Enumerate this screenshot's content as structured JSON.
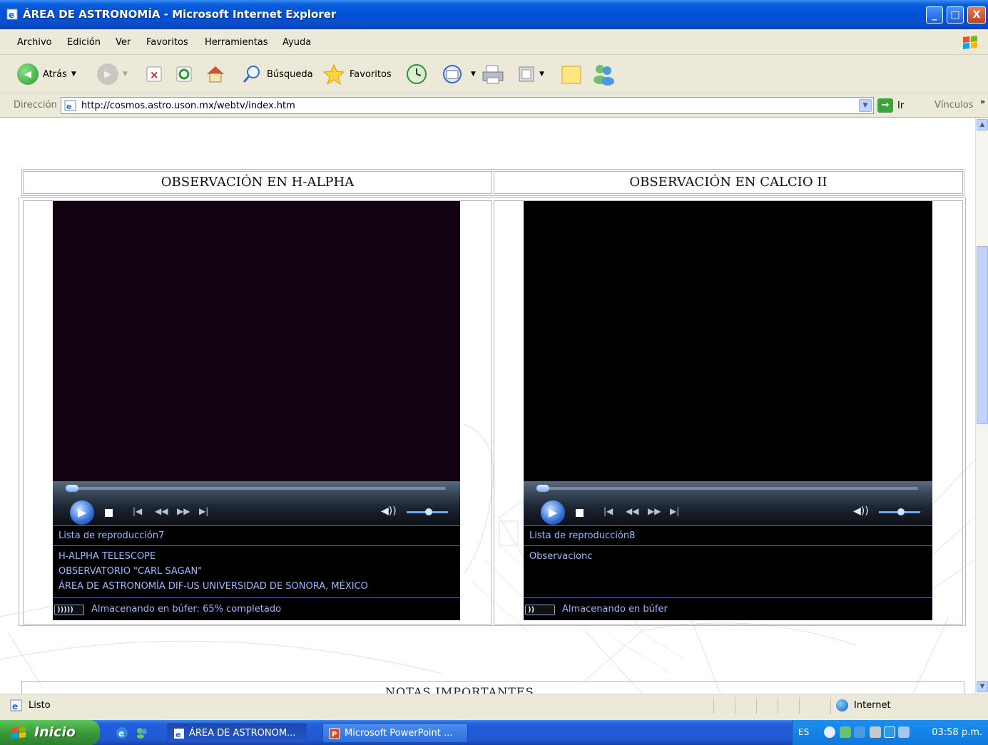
{
  "window": {
    "title": "ÁREA DE ASTRONOMÍA - Microsoft Internet Explorer",
    "btn_min": "_",
    "btn_max": "□",
    "btn_close": "X"
  },
  "menu": [
    "Archivo",
    "Edición",
    "Ver",
    "Favoritos",
    "Herramientas",
    "Ayuda"
  ],
  "toolbar": {
    "back_label": "Atrás",
    "search_label": "Búsqueda",
    "favorites_label": "Favoritos"
  },
  "address": {
    "label": "Dirección",
    "url": "http://cosmos.astro.uson.mx/webtv/index.htm",
    "go_label": "Ir",
    "links_label": "Vínculos"
  },
  "page": {
    "left_header": "OBSERVACIÓN EN H-ALPHA",
    "right_header": "OBSERVACIÓN EN CALCIO II",
    "notas_partial": "NOTAS IMPORTANTES",
    "left_player": {
      "video_color": "#12010f",
      "playlist": "Lista de reproducción7",
      "lines": [
        "H-ALPHA TELESCOPE",
        "OBSERVATORIO \"CARL SAGAN\"",
        "ÁREA DE ASTRONOMÍA DIF-US UNIVERSIDAD DE SONORA, MÉXICO"
      ],
      "buffer_icon": ")))))",
      "status": "Almacenando en búfer: 65% completado"
    },
    "right_player": {
      "video_color": "#000000",
      "playlist": "Lista de reproducción8",
      "lines": [
        "Observacionc"
      ],
      "buffer_icon": "))",
      "status": "Almacenando en búfer"
    }
  },
  "statusbar": {
    "text": "Listo",
    "zone": "Internet"
  },
  "taskbar": {
    "start": "Inicio",
    "tasks": [
      "ÁREA DE ASTRONOM...",
      "Microsoft PowerPoint ..."
    ],
    "lang": "ES",
    "clock": "03:58 p.m."
  }
}
